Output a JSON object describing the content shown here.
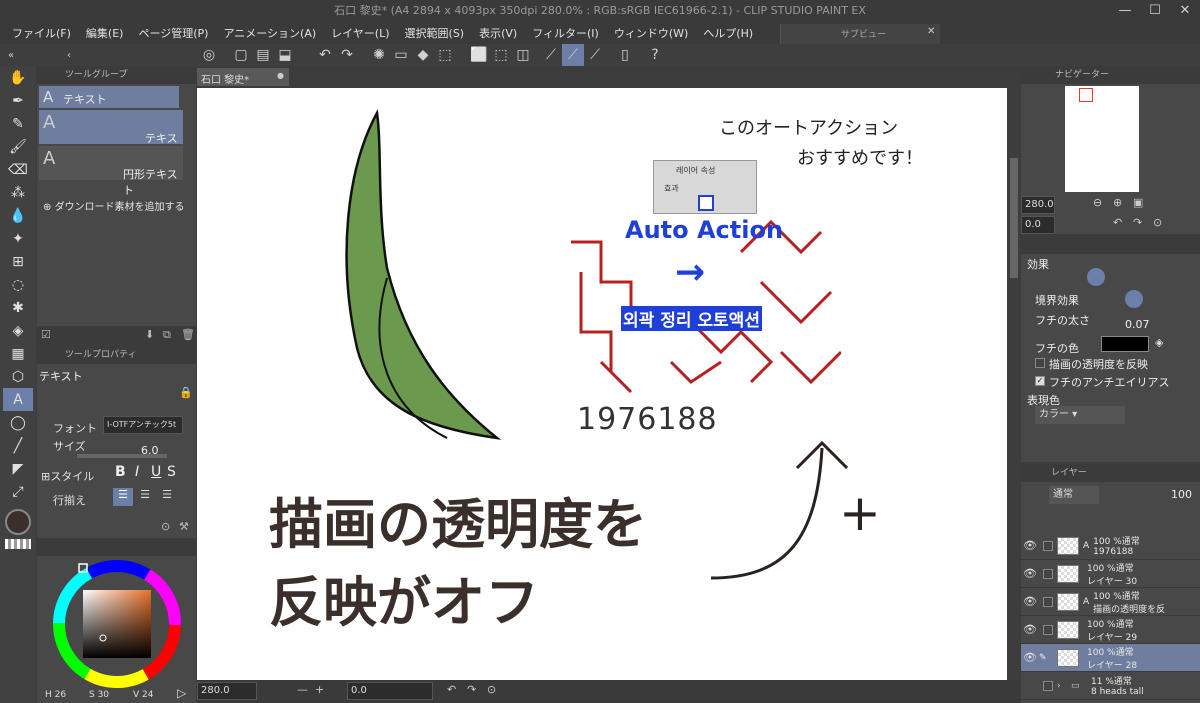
{
  "window": {
    "title": "石口 黎史* (A4 2894 x 4093px 350dpi 280.0% : RGB:sRGB IEC61966-2.1)  - CLIP STUDIO PAINT EX",
    "sub_view_label": "サブビュー",
    "min": "—",
    "max": "☐",
    "close": "✕"
  },
  "menu": [
    "ファイル(F)",
    "編集(E)",
    "ページ管理(P)",
    "アニメーション(A)",
    "レイヤー(L)",
    "選択範囲(S)",
    "表示(V)",
    "フィルター(I)",
    "ウィンドウ(W)",
    "ヘルプ(H)"
  ],
  "tab": {
    "doc": "石口 黎史*"
  },
  "subtool": {
    "header": "ツールグループ",
    "items": [
      "テキスト",
      "テキスト",
      "円形テキスト"
    ],
    "download": "ダウンロード素材を追加する"
  },
  "toolprop": {
    "header": "ツールプロパティ",
    "name": "テキスト",
    "font_label": "フォント",
    "font_value": "I-OTFアンチック5t",
    "size_label": "サイズ",
    "size_value": "6.0",
    "style_label": "スタイル",
    "align_label": "行揃え"
  },
  "color": {
    "h": "H 26",
    "s": "S 30",
    "v": "V 24"
  },
  "canvas": {
    "annot_top1": "このオートアクション",
    "annot_top2": "おすすめです！",
    "small_tab": "레이어 속성",
    "small_effect": "효과",
    "auto_action": "Auto Action",
    "arrow": "→",
    "korean": "외곽 정리 오토액션",
    "number": "1976188",
    "big_line1": "描画の透明度を",
    "big_line2": "反映がオフ",
    "plus": "+"
  },
  "statusbar": {
    "zoom": "280.0",
    "angle": "0.0"
  },
  "navigator": {
    "header": "ナビゲーター",
    "zoom": "280.0",
    "rotate": "0.0"
  },
  "layerprop": {
    "effect_label": "効果",
    "border_effect": "境界効果",
    "width_label": "フチの太さ",
    "width_value": "0.07",
    "color_label": "フチの色",
    "opt1": "描画の透明度を反映",
    "opt2": "フチのアンチエイリアス",
    "expression_label": "表現色",
    "expression_value": "カラー",
    "colors": {
      "border": "#000000"
    }
  },
  "layers": {
    "header": "レイヤー",
    "blend": "通常",
    "opacity": "100",
    "rows": [
      {
        "mode": "100 %通常",
        "name": "1976188",
        "type": "A"
      },
      {
        "mode": "100 %通常",
        "name": "レイヤー 30",
        "type": ""
      },
      {
        "mode": "100 %通常",
        "name": "描画の透明度を反",
        "type": "A"
      },
      {
        "mode": "100 %通常",
        "name": "レイヤー 29",
        "type": ""
      },
      {
        "mode": "100 %通常",
        "name": "レイヤー 28",
        "type": ""
      },
      {
        "mode": "11 %通常",
        "name": "8 heads tall",
        "type": ""
      }
    ]
  }
}
